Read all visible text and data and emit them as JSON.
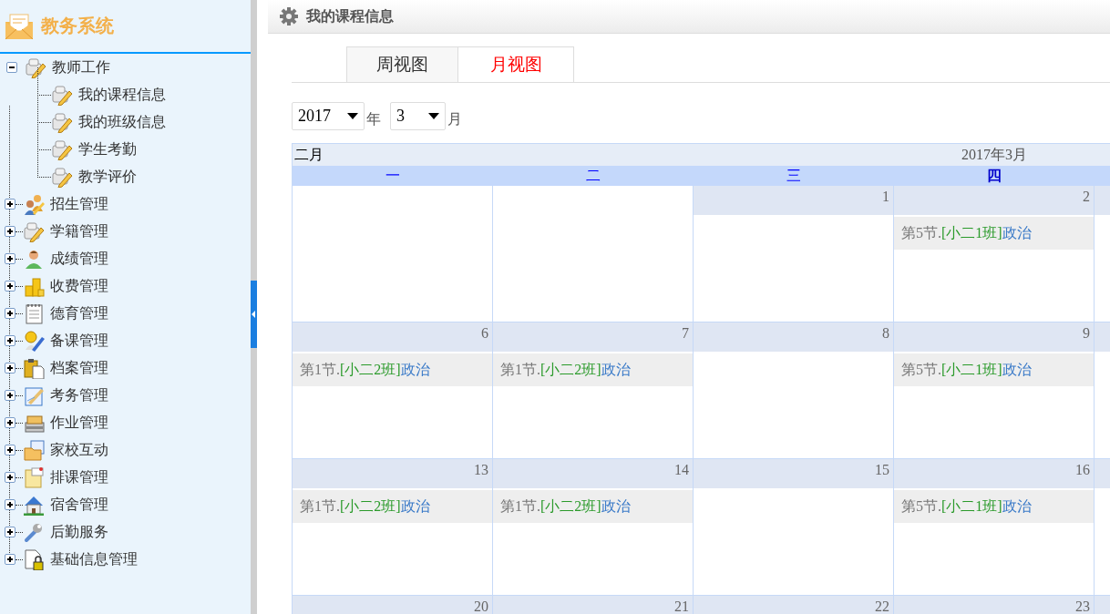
{
  "sidebar": {
    "title": "教务系统",
    "tree": [
      {
        "label": "教师工作",
        "kind": "blocks",
        "expanded": true,
        "children": [
          {
            "label": "我的课程信息",
            "kind": "blocks"
          },
          {
            "label": "我的班级信息",
            "kind": "blocks"
          },
          {
            "label": "学生考勤",
            "kind": "blocks"
          },
          {
            "label": "教学评价",
            "kind": "blocks"
          }
        ]
      },
      {
        "label": "招生管理",
        "kind": "people",
        "expanded": false
      },
      {
        "label": "学籍管理",
        "kind": "blocks",
        "expanded": false
      },
      {
        "label": "成绩管理",
        "kind": "person",
        "expanded": false
      },
      {
        "label": "收费管理",
        "kind": "coins",
        "expanded": false
      },
      {
        "label": "德育管理",
        "kind": "notepad",
        "expanded": false
      },
      {
        "label": "备课管理",
        "kind": "pencil",
        "expanded": false
      },
      {
        "label": "档案管理",
        "kind": "clipboard",
        "expanded": false
      },
      {
        "label": "考务管理",
        "kind": "document",
        "expanded": false
      },
      {
        "label": "作业管理",
        "kind": "drawers",
        "expanded": false
      },
      {
        "label": "家校互动",
        "kind": "folder",
        "expanded": false
      },
      {
        "label": "排课管理",
        "kind": "note",
        "expanded": false
      },
      {
        "label": "宿舍管理",
        "kind": "house",
        "expanded": false
      },
      {
        "label": "后勤服务",
        "kind": "wrench",
        "expanded": false
      },
      {
        "label": "基础信息管理",
        "kind": "lock",
        "expanded": false
      }
    ]
  },
  "page": {
    "title": "我的课程信息",
    "tabs": [
      {
        "label": "周视图",
        "selected": false
      },
      {
        "label": "月视图",
        "selected": true
      }
    ],
    "year": {
      "value": "2017",
      "unit": "年"
    },
    "month": {
      "value": "3",
      "unit": "月"
    },
    "calendar": {
      "prev": "二月",
      "title": "2017年3月",
      "weekdays": [
        {
          "label": "一",
          "current": false
        },
        {
          "label": "二",
          "current": false
        },
        {
          "label": "三",
          "current": false
        },
        {
          "label": "四",
          "current": true
        }
      ],
      "weeks": [
        {
          "days": [
            {
              "in_month": false
            },
            {
              "in_month": false
            },
            {
              "in_month": true,
              "date": "1"
            },
            {
              "in_month": true,
              "date": "2",
              "events": [
                {
                  "period": "第5节.",
                  "class": "[小二1班]",
                  "subject": "政治"
                }
              ]
            },
            {
              "in_month": true
            }
          ]
        },
        {
          "days": [
            {
              "in_month": true,
              "date": "6",
              "events": [
                {
                  "period": "第1节.",
                  "class": "[小二2班]",
                  "subject": "政治"
                }
              ]
            },
            {
              "in_month": true,
              "date": "7",
              "events": [
                {
                  "period": "第1节.",
                  "class": "[小二2班]",
                  "subject": "政治"
                }
              ]
            },
            {
              "in_month": true,
              "date": "8"
            },
            {
              "in_month": true,
              "date": "9",
              "events": [
                {
                  "period": "第5节.",
                  "class": "[小二1班]",
                  "subject": "政治"
                }
              ]
            },
            {
              "in_month": true
            }
          ]
        },
        {
          "days": [
            {
              "in_month": true,
              "date": "13",
              "events": [
                {
                  "period": "第1节.",
                  "class": "[小二2班]",
                  "subject": "政治"
                }
              ]
            },
            {
              "in_month": true,
              "date": "14",
              "events": [
                {
                  "period": "第1节.",
                  "class": "[小二2班]",
                  "subject": "政治"
                }
              ]
            },
            {
              "in_month": true,
              "date": "15"
            },
            {
              "in_month": true,
              "date": "16",
              "events": [
                {
                  "period": "第5节.",
                  "class": "[小二1班]",
                  "subject": "政治"
                }
              ]
            },
            {
              "in_month": true
            }
          ]
        },
        {
          "days": [
            {
              "in_month": true,
              "date": "20"
            },
            {
              "in_month": true,
              "date": "21"
            },
            {
              "in_month": true,
              "date": "22"
            },
            {
              "in_month": true,
              "date": "23"
            },
            {
              "in_month": true
            }
          ]
        }
      ]
    }
  }
}
